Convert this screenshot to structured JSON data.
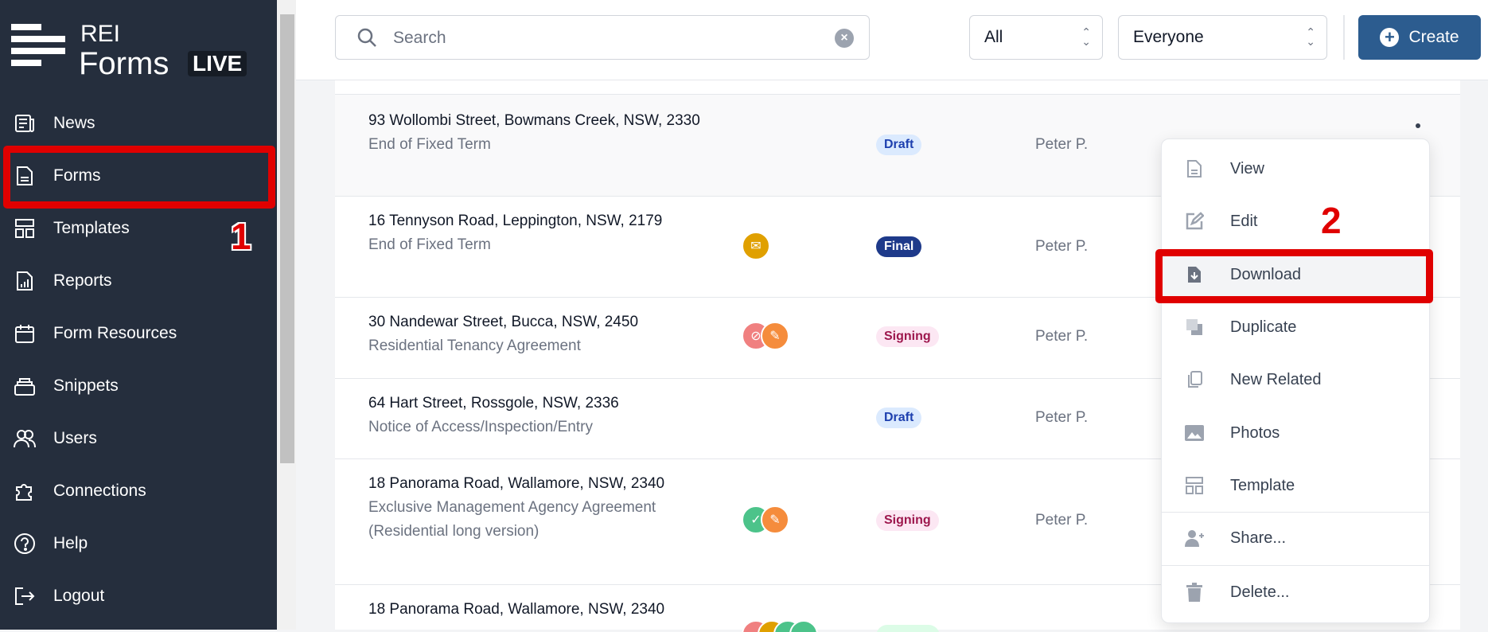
{
  "brand": {
    "rei": "REI",
    "forms": "Forms",
    "live": "LIVE"
  },
  "sidebar": {
    "items": [
      {
        "label": "News",
        "icon": "newspaper-icon"
      },
      {
        "label": "Forms",
        "icon": "document-icon"
      },
      {
        "label": "Templates",
        "icon": "template-icon"
      },
      {
        "label": "Reports",
        "icon": "report-icon"
      },
      {
        "label": "Form Resources",
        "icon": "calendar-icon"
      },
      {
        "label": "Snippets",
        "icon": "stack-icon"
      },
      {
        "label": "Users",
        "icon": "users-icon"
      },
      {
        "label": "Connections",
        "icon": "puzzle-icon"
      },
      {
        "label": "Help",
        "icon": "help-icon"
      },
      {
        "label": "Logout",
        "icon": "logout-icon"
      }
    ]
  },
  "header": {
    "search_placeholder": "Search",
    "filter_status": "All",
    "filter_owner": "Everyone",
    "create_label": "Create"
  },
  "rows": [
    {
      "address": "93 Wollombi Street, Bowmans Creek, NSW, 2330",
      "form": "End of Fixed Term",
      "status": "Draft",
      "owner": "Peter P."
    },
    {
      "address": "16 Tennyson Road, Leppington, NSW, 2179",
      "form": "End of Fixed Term",
      "status": "Final",
      "owner": "Peter P."
    },
    {
      "address": "30 Nandewar Street, Bucca, NSW, 2450",
      "form": "Residential Tenancy Agreement",
      "status": "Signing",
      "owner": "Peter P."
    },
    {
      "address": "64 Hart Street, Rossgole, NSW, 2336",
      "form": "Notice of Access/Inspection/Entry",
      "status": "Draft",
      "owner": "Peter P."
    },
    {
      "address": "18 Panorama Road, Wallamore, NSW, 2340",
      "form": "Exclusive Management Agency Agreement (Residential long version)",
      "status": "Signing",
      "owner": "Peter P."
    },
    {
      "address": "18 Panorama Road, Wallamore, NSW, 2340"
    }
  ],
  "menu": {
    "items": [
      "View",
      "Edit",
      "Download",
      "Duplicate",
      "New Related",
      "Photos",
      "Template",
      "Share...",
      "Delete..."
    ]
  },
  "annotations": {
    "step1": "1",
    "step2": "2"
  },
  "colors": {
    "sidebar": "#252e3d",
    "primary": "#2c5c8f",
    "highlight": "#e00000"
  }
}
